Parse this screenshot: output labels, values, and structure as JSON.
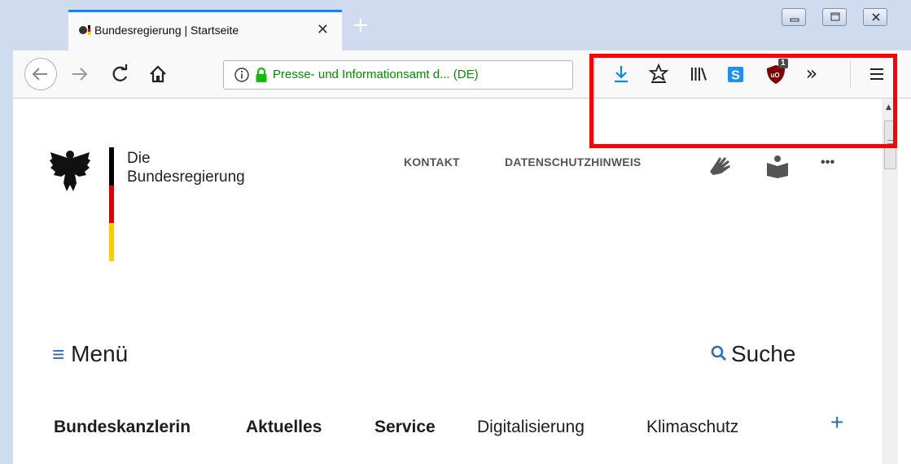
{
  "browser": {
    "tab": {
      "title": "Bundesregierung | Startseite",
      "close_symbol": "✕"
    },
    "new_tab_symbol": "+",
    "url_identity": "Presse- und Informationsamt d... (DE)",
    "extension_badge": "1",
    "overflow_symbol": "»",
    "menu_symbol": "≡"
  },
  "site": {
    "wordmark_line1": "Die",
    "wordmark_line2": "Bundesregierung",
    "top_links": [
      "KONTAKT",
      "DATENSCHUTZHINWEIS"
    ],
    "more_symbol": "•••",
    "menu_label": "Menü",
    "search_label": "Suche",
    "nav_items": [
      "Bundeskanzlerin",
      "Aktuelles",
      "Service",
      "Digitalisierung",
      "Klimaschutz"
    ],
    "plus_symbol": "+",
    "flag_colors": [
      "#000000",
      "#dd0000",
      "#ffcc00"
    ]
  },
  "colors": {
    "accent": "#0a84ff",
    "secure_green": "#058b00",
    "site_blue": "#2a6ebb",
    "highlight_red": "#ff0000"
  },
  "icons": {
    "toolbar": [
      "download-icon",
      "bookmark-star-icon",
      "library-icon",
      "s-extension-icon",
      "ublock-icon",
      "overflow-icon",
      "hamburger-menu-icon"
    ],
    "site": [
      "sign-language-icon",
      "easy-language-icon",
      "more-icon"
    ]
  }
}
